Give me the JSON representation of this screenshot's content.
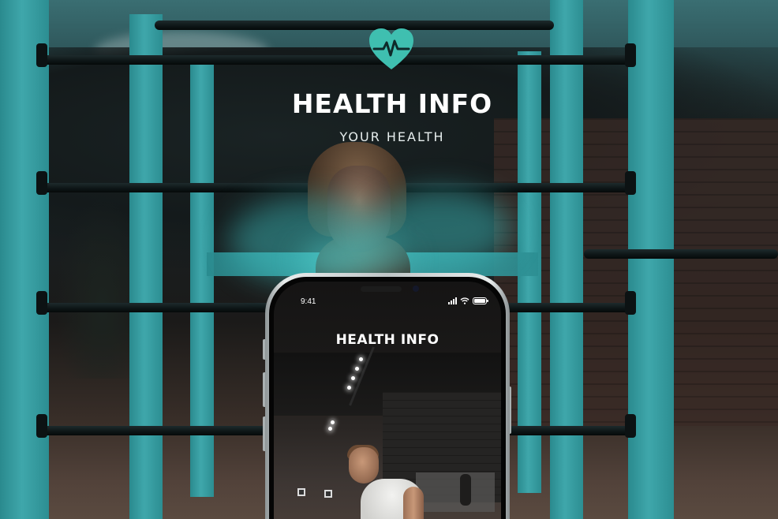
{
  "hero": {
    "logo_icon": "heart-pulse-icon",
    "title": "HEALTH INFO",
    "subtitle": "YOUR HEALTH",
    "accent_color": "#3fbfb0"
  },
  "phone": {
    "status_bar": {
      "time": "9:41",
      "signal_icon": "cellular-signal-icon",
      "wifi_icon": "wifi-icon",
      "battery_icon": "battery-icon"
    },
    "app_title": "HEALTH INFO"
  }
}
